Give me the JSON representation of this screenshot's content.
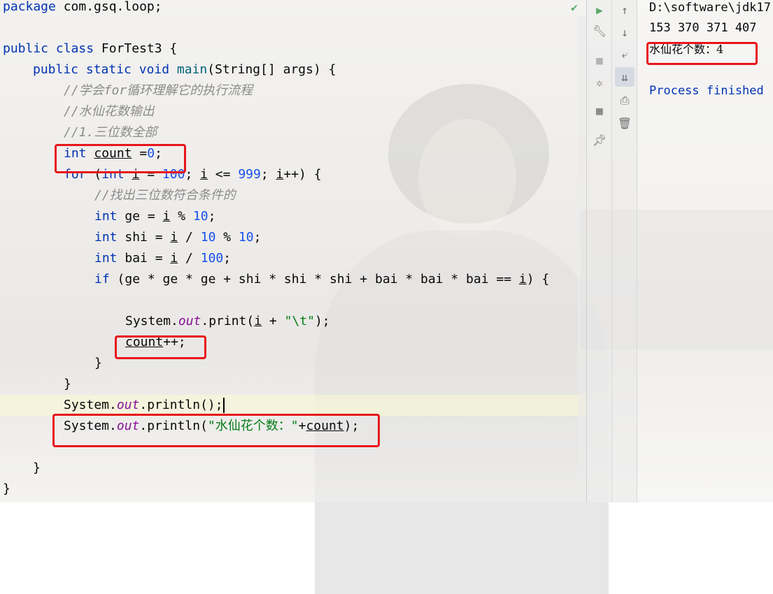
{
  "editor": {
    "lines": {
      "l1_pkg_kw": "package",
      "l1_pkg_name": " com.gsq.loop;",
      "l3_public": "public",
      "l3_class": " class",
      "l3_name": " ForTest3 {",
      "l4_indent": "    ",
      "l4_public": "public",
      "l4_static": " static",
      "l4_void": " void",
      "l4_main": " main",
      "l4_rest": "(String[] args) {",
      "c1": "//学会for循环理解它的执行流程",
      "c2": "//水仙花数输出",
      "c3": "//1.三位数全部",
      "l8_int": "int",
      "l8_count": "count",
      "l8_eq": " =",
      "l8_zero": "0",
      "l8_semi": ";",
      "l9_for": "for",
      "l9_p1": " (",
      "l9_int": "int",
      "l9_sp": " ",
      "l9_i": "i",
      "l9_eq": " = ",
      "l9_100": "100",
      "l9_semi": "; ",
      "l9_i2": "i",
      "l9_le": " <= ",
      "l9_999": "999",
      "l9_semi2": "; ",
      "l9_i3": "i",
      "l9_end": "++) {",
      "c4": "//找出三位数符合条件的",
      "l11_int": "int",
      "l11_a": " ge = ",
      "l11_i": "i",
      "l11_b": " % ",
      "l11_10": "10",
      "l11_c": ";",
      "l12_int": "int",
      "l12_a": " shi = ",
      "l12_i": "i",
      "l12_b": " / ",
      "l12_10": "10",
      "l12_c": " % ",
      "l12_10b": "10",
      "l12_d": ";",
      "l13_int": "int",
      "l13_a": " bai = ",
      "l13_i": "i",
      "l13_b": " / ",
      "l13_100": "100",
      "l13_c": ";",
      "l14_if": "if",
      "l14_a": " (ge * ge * ge + shi * shi * shi + bai * bai * bai == ",
      "l14_i": "i",
      "l14_b": ") {",
      "l16_sys": "System.",
      "l16_out": "out",
      "l16_print": ".print(",
      "l16_i": "i",
      "l16_plus": " + ",
      "l16_str": "\"\\t\"",
      "l16_end": ");",
      "l17_count": "count",
      "l17_end": "++;",
      "l18": "}",
      "l19": "}",
      "l20_sys": "System.",
      "l20_out": "out",
      "l20_rest": ".println();",
      "l21_sys": "System.",
      "l21_out": "out",
      "l21_a": ".println(",
      "l21_str": "\"水仙花个数：\"",
      "l21_plus": "+",
      "l21_count": "count",
      "l21_end": ");",
      "l23": "}",
      "l24": "}"
    }
  },
  "console": {
    "cmd": "D:\\software\\jdk17",
    "output_numbers": "153 370 371 407",
    "count_line": "水仙花个数：4",
    "finished": "Process finished"
  },
  "icons": [
    "check-icon",
    "run-icon",
    "wrench-icon",
    "stop-icon",
    "rerun-debug-icon",
    "layout-icon",
    "pin-icon",
    "arrow-up-icon",
    "arrow-down-icon",
    "soft-wrap-icon",
    "scroll-to-end-icon",
    "print-icon",
    "trash-icon"
  ],
  "colors": {
    "highlight_box": "#e8151b",
    "keyword": "#0033b3",
    "number": "#1750eb",
    "comment": "#8c8c8c",
    "string": "#067d17",
    "field": "#871094"
  }
}
